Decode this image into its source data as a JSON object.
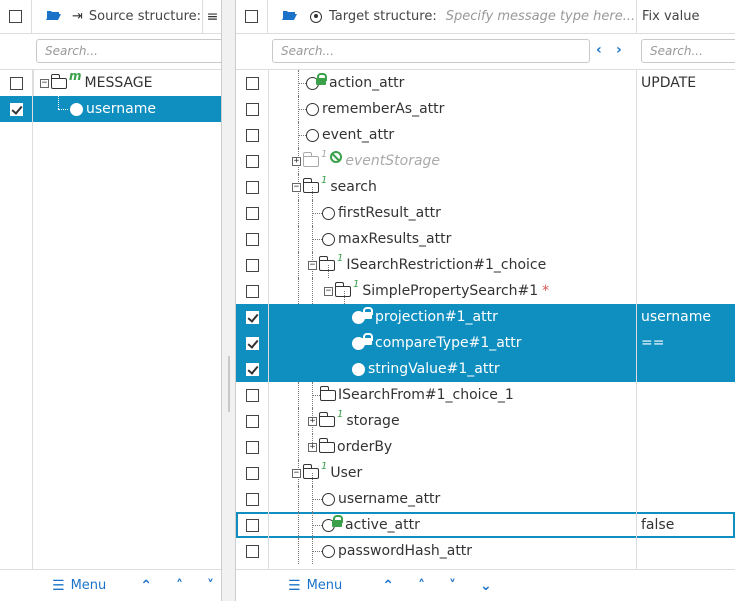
{
  "left": {
    "header": {
      "title": "Source structure:",
      "mode_icon": "login-arrow-icon"
    },
    "search": {
      "placeholder": "Search..."
    },
    "rows": [
      {
        "label": "MESSAGE",
        "badge": "m",
        "checked": false,
        "selected": false
      },
      {
        "label": "username",
        "checked": true,
        "selected": true
      }
    ],
    "footer": {
      "menu_label": "Menu"
    }
  },
  "right": {
    "header": {
      "title": "Target structure:",
      "type_placeholder": "Specify message type here...",
      "fix_column": "Fix value"
    },
    "search": {
      "placeholder": "Search...",
      "fix_placeholder": "Search..."
    },
    "rows": [
      {
        "label": "action_attr",
        "fix": "UPDATE"
      },
      {
        "label": "rememberAs_attr",
        "fix": ""
      },
      {
        "label": "event_attr",
        "fix": ""
      },
      {
        "label": "eventStorage",
        "fix": "",
        "badge": "1"
      },
      {
        "label": "search",
        "fix": "",
        "badge": "1"
      },
      {
        "label": "firstResult_attr",
        "fix": ""
      },
      {
        "label": "maxResults_attr",
        "fix": ""
      },
      {
        "label": "ISearchRestriction#1_choice",
        "fix": "",
        "badge": "1"
      },
      {
        "label": "SimplePropertySearch#1",
        "fix": "",
        "badge": "1",
        "required": "*"
      },
      {
        "label": "projection#1_attr",
        "fix": "username",
        "checked": true
      },
      {
        "label": "compareType#1_attr",
        "fix": "==",
        "checked": true
      },
      {
        "label": "stringValue#1_attr",
        "fix": "",
        "checked": true
      },
      {
        "label": "ISearchFrom#1_choice_1",
        "fix": ""
      },
      {
        "label": "storage",
        "fix": "",
        "badge": "1"
      },
      {
        "label": "orderBy",
        "fix": ""
      },
      {
        "label": "User",
        "fix": "",
        "badge": "1"
      },
      {
        "label": "username_attr",
        "fix": ""
      },
      {
        "label": "active_attr",
        "fix": "false"
      },
      {
        "label": "passwordHash_attr",
        "fix": ""
      }
    ],
    "footer": {
      "menu_label": "Menu"
    }
  },
  "colors": {
    "selection": "#0f8fc0",
    "accent": "#1a73c9",
    "badge": "#3aa04a"
  }
}
